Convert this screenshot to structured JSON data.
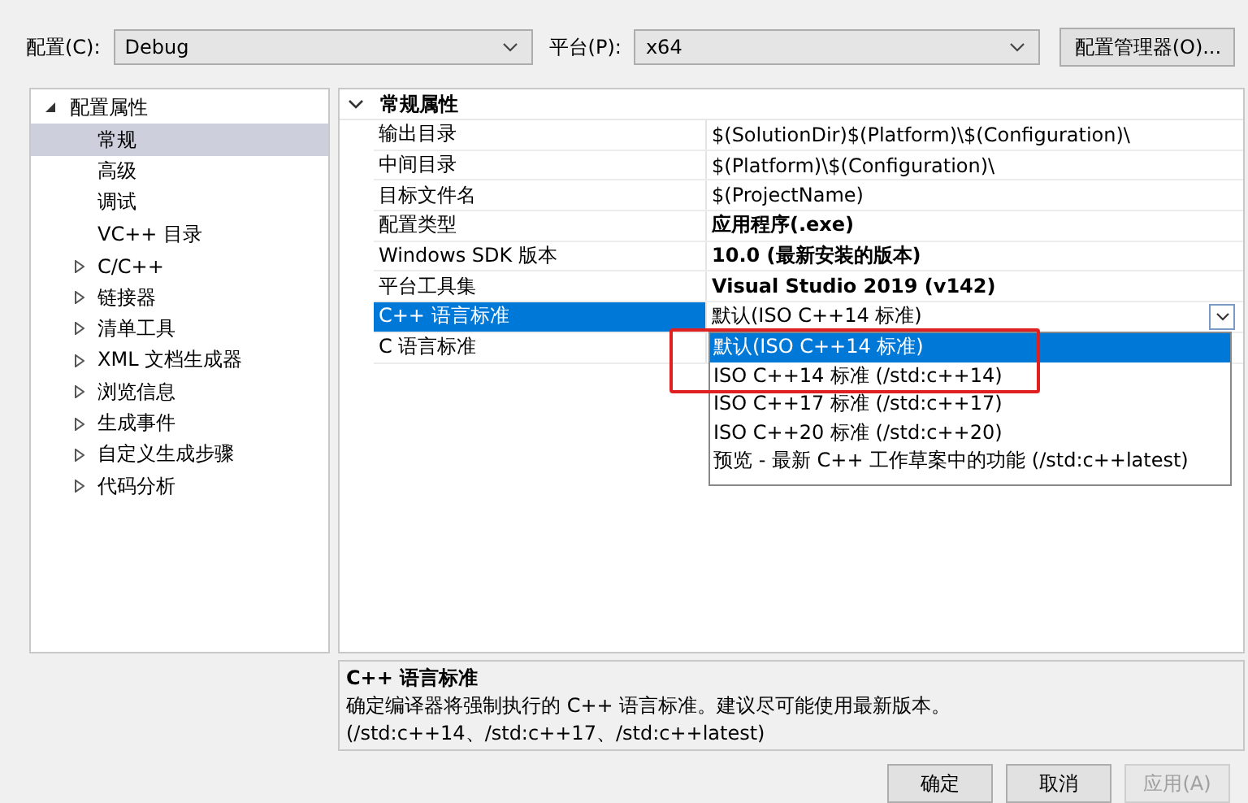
{
  "toolbar": {
    "config_label": "配置(C):",
    "config_value": "Debug",
    "platform_label": "平台(P):",
    "platform_value": "x64",
    "manager_button": "配置管理器(O)..."
  },
  "sidebar": {
    "items": [
      {
        "label": "配置属性",
        "expanded": true,
        "selected": false,
        "children": [
          {
            "label": "常规",
            "selected": true
          },
          {
            "label": "高级",
            "selected": false
          },
          {
            "label": "调试",
            "selected": false
          },
          {
            "label": "VC++ 目录",
            "selected": false
          },
          {
            "label": "C/C++",
            "selected": false,
            "expanded": false
          },
          {
            "label": "链接器",
            "selected": false,
            "expanded": false
          },
          {
            "label": "清单工具",
            "selected": false,
            "expanded": false
          },
          {
            "label": "XML 文档生成器",
            "selected": false,
            "expanded": false
          },
          {
            "label": "浏览信息",
            "selected": false,
            "expanded": false
          },
          {
            "label": "生成事件",
            "selected": false,
            "expanded": false
          },
          {
            "label": "自定义生成步骤",
            "selected": false,
            "expanded": false
          },
          {
            "label": "代码分析",
            "selected": false,
            "expanded": false
          }
        ]
      }
    ]
  },
  "property_grid": {
    "section": {
      "label": "常规属性",
      "expanded": true
    },
    "rows": [
      {
        "name": "输出目录",
        "value": "$(SolutionDir)$(Platform)\\$(Configuration)\\",
        "bold": false,
        "selected": false
      },
      {
        "name": "中间目录",
        "value": "$(Platform)\\$(Configuration)\\",
        "bold": false,
        "selected": false
      },
      {
        "name": "目标文件名",
        "value": "$(ProjectName)",
        "bold": false,
        "selected": false
      },
      {
        "name": "配置类型",
        "value": "应用程序(.exe)",
        "bold": true,
        "selected": false
      },
      {
        "name": "Windows SDK 版本",
        "value": "10.0 (最新安装的版本)",
        "bold": true,
        "selected": false
      },
      {
        "name": "平台工具集",
        "value": "Visual Studio 2019 (v142)",
        "bold": true,
        "selected": false
      },
      {
        "name": "C++ 语言标准",
        "value": "默认(ISO C++14 标准)",
        "bold": false,
        "selected": true
      },
      {
        "name": "C 语言标准",
        "selected": false
      }
    ],
    "dropdown_options": [
      {
        "label": "默认(ISO C++14 标准)",
        "selected": true
      },
      {
        "label": "ISO C++14 标准 (/std:c++14)",
        "selected": false
      },
      {
        "label": "ISO C++17 标准 (/std:c++17)",
        "selected": false
      },
      {
        "label": "ISO C++20 标准 (/std:c++20)",
        "selected": false
      },
      {
        "label": "预览 - 最新 C++ 工作草案中的功能 (/std:c++latest)",
        "selected": false
      }
    ]
  },
  "description": {
    "title": "C++ 语言标准",
    "text": "确定编译器将强制执行的 C++ 语言标准。建议尽可能使用最新版本。(/std:c++14、/std:c++17、/std:c++latest)"
  },
  "buttons": [
    {
      "label": "确定",
      "disabled": false
    },
    {
      "label": "取消",
      "disabled": false
    },
    {
      "label": "应用(A)",
      "disabled": true
    }
  ]
}
